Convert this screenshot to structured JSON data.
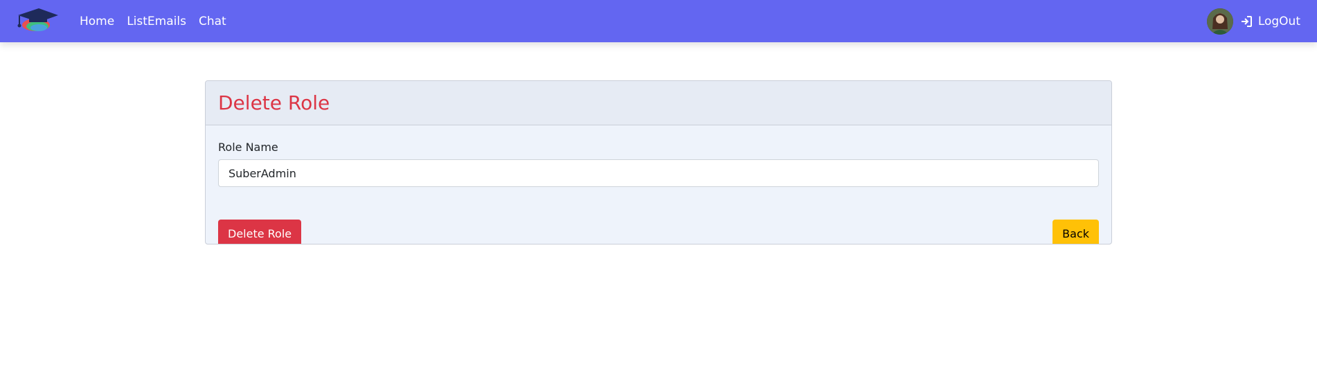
{
  "navbar": {
    "brand_icon": "graduation-cap-logo",
    "links": [
      "Home",
      "ListEmails",
      "Chat"
    ],
    "logout_label": "LogOut",
    "logout_icon": "sign-in-icon"
  },
  "card": {
    "title": "Delete Role",
    "role_name_label": "Role Name",
    "role_name_value": "SuberAdmin",
    "delete_button": "Delete Role",
    "back_button": "Back"
  },
  "colors": {
    "navbar": "#6366f1",
    "danger": "#dc3545",
    "warning": "#ffc107"
  }
}
